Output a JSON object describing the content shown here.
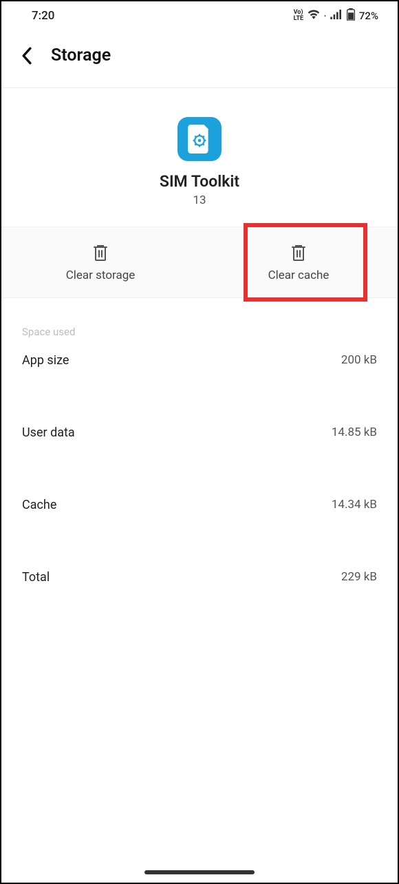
{
  "statusBar": {
    "time": "7:20",
    "volte": "Vo)\nLTE",
    "battery": "72%"
  },
  "header": {
    "title": "Storage"
  },
  "app": {
    "name": "SIM Toolkit",
    "version": "13"
  },
  "actions": {
    "clearStorage": "Clear storage",
    "clearCache": "Clear cache"
  },
  "spaceUsed": {
    "header": "Space used",
    "rows": [
      {
        "label": "App size",
        "value": "200 kB"
      },
      {
        "label": "User data",
        "value": "14.85 kB"
      },
      {
        "label": "Cache",
        "value": "14.34 kB"
      },
      {
        "label": "Total",
        "value": "229 kB"
      }
    ]
  }
}
